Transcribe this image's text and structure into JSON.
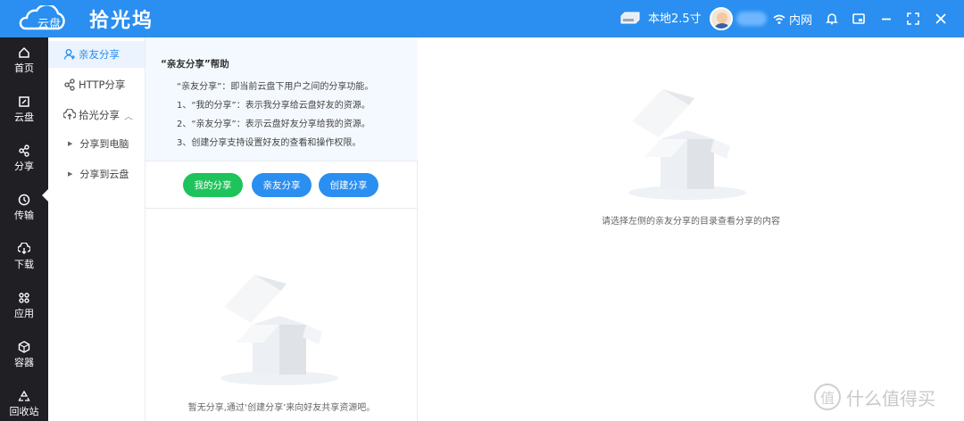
{
  "app": {
    "logo_cloud_text": "云盘",
    "logo_name": "拾光坞",
    "brand_color": "#2a8ff0"
  },
  "topbar": {
    "storage_label": "本地2.5寸",
    "network_label": "内网",
    "icons": [
      "hdd-icon",
      "avatar",
      "wifi-icon",
      "bell-icon",
      "picture-in-picture-icon",
      "minimize-icon",
      "fullscreen-icon",
      "close-icon"
    ]
  },
  "leftnav": {
    "items": [
      {
        "label": "首页",
        "icon": "home-icon"
      },
      {
        "label": "云盘",
        "icon": "cloud-disk-icon"
      },
      {
        "label": "分享",
        "icon": "share-icon"
      },
      {
        "label": "传输",
        "icon": "transfer-icon"
      },
      {
        "label": "下载",
        "icon": "download-icon"
      },
      {
        "label": "应用",
        "icon": "apps-icon"
      },
      {
        "label": "容器",
        "icon": "container-icon"
      },
      {
        "label": "回收站",
        "icon": "recycle-icon"
      }
    ],
    "active_index": 2
  },
  "subnav": {
    "items": [
      {
        "label": "亲友分享",
        "icon": "friends-share-icon",
        "active": true
      },
      {
        "label": "HTTP分享",
        "icon": "http-share-icon",
        "active": false
      },
      {
        "label": "拾光分享",
        "icon": "cloud-share-icon",
        "active": false
      }
    ],
    "children": [
      {
        "label": "分享到电脑"
      },
      {
        "label": "分享到云盘"
      }
    ]
  },
  "help": {
    "title": "“亲友分享”帮助",
    "lines": [
      "“亲友分享”：即当前云盘下用户之间的分享功能。",
      "1、“我的分享”：表示我分享给云盘好友的资源。",
      "2、“亲友分享”：表示云盘好友分享给我的资源。",
      "3、创建分享支持设置好友的查看和操作权限。"
    ]
  },
  "buttons": {
    "my_share": "我的分享",
    "friends_share": "亲友分享",
    "create_share": "创建分享"
  },
  "empty": {
    "left_text": "暂无分享,通过‘创建分享’来向好友共享资源吧。",
    "right_text": "请选择左侧的亲友分享的目录查看分享的内容"
  },
  "watermark": {
    "text": "什么值得买",
    "icon_char": "值"
  }
}
